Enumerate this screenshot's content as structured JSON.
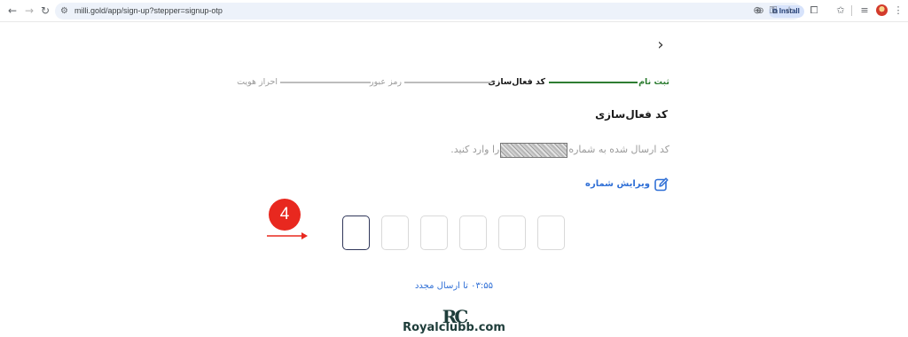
{
  "browser": {
    "url": "milli.gold/app/sign-up?stepper=signup-otp",
    "install_label": "Install"
  },
  "stepper": {
    "steps": [
      {
        "label": "ثبت نام",
        "state": "done"
      },
      {
        "label": "کد فعال‌سازی",
        "state": "active"
      },
      {
        "label": "رمز عبور",
        "state": "pending"
      },
      {
        "label": "احراز هویت",
        "state": "pending"
      }
    ]
  },
  "form": {
    "title": "کد فعال‌سازی",
    "description_before": "کد ارسال شده به شماره",
    "description_after": "را وارد کنید.",
    "edit_number_label": "ویرایش شماره",
    "otp_digits": [
      "",
      "",
      "",
      "",
      "",
      ""
    ],
    "resend_timer": "۰۳:۵۵",
    "resend_label": "تا ارسال مجدد"
  },
  "annotation": {
    "step_number": "4",
    "color": "#e8281f"
  },
  "watermark": {
    "logo_text": "RC",
    "text": "Royalclubb.com"
  },
  "colors": {
    "accent_green": "#2e7d32",
    "link_blue": "#2f6fd6",
    "focused_border": "#30375a"
  }
}
